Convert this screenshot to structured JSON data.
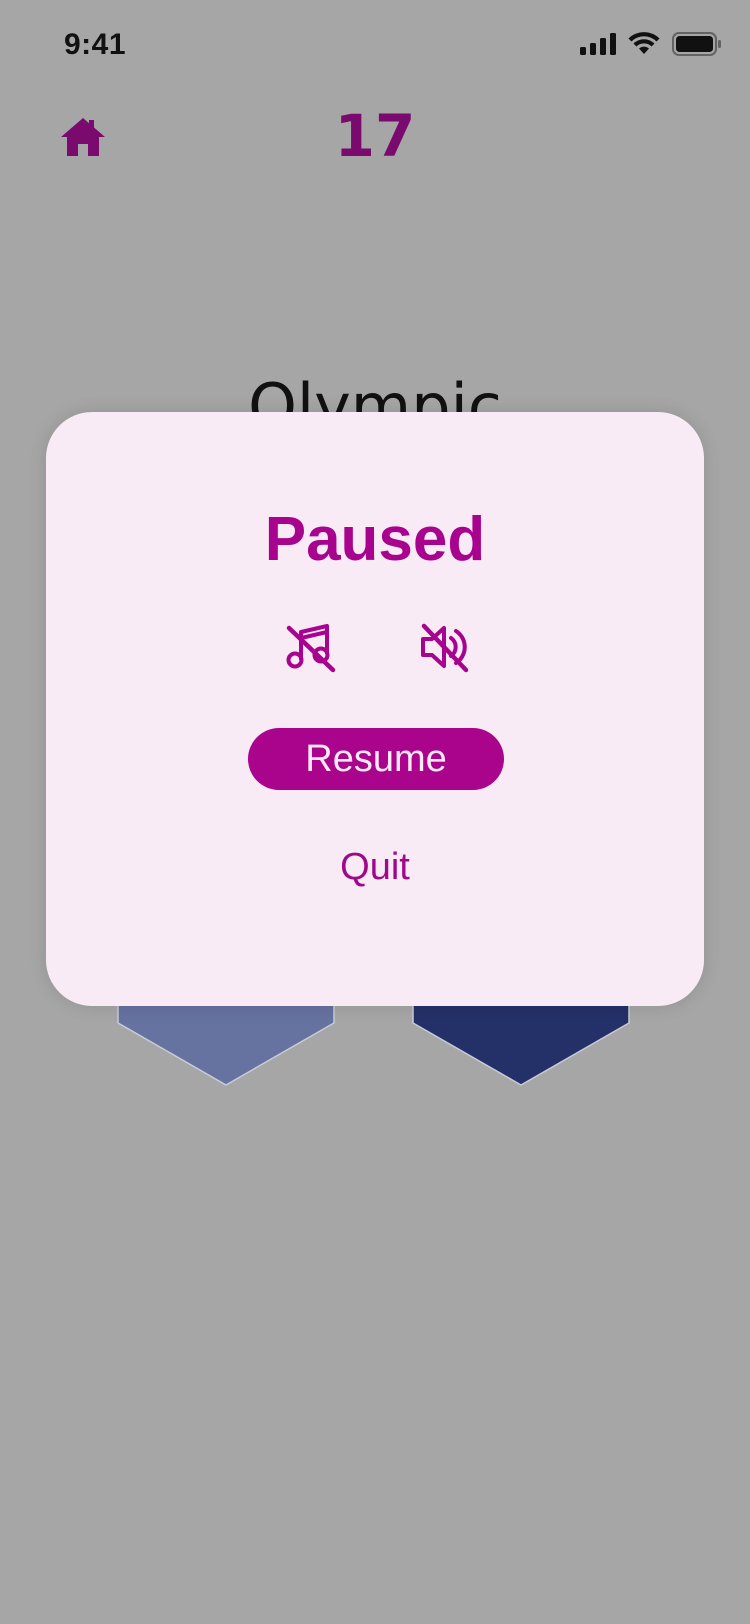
{
  "status_bar": {
    "time": "9:41"
  },
  "header": {
    "home_icon": "home-icon",
    "score": "17"
  },
  "question": {
    "text": "Olympic"
  },
  "answers": {
    "left_color": "#66729f",
    "right_color": "#243068"
  },
  "pause_modal": {
    "title": "Paused",
    "music_icon": "music-off-icon",
    "sound_icon": "volume-off-icon",
    "resume_label": "Resume",
    "quit_label": "Quit"
  },
  "colors": {
    "accent": "#aa038c",
    "score": "#7a0a6e",
    "modal_bg": "#f8ebf6",
    "overlay": "#a6a6a6"
  }
}
